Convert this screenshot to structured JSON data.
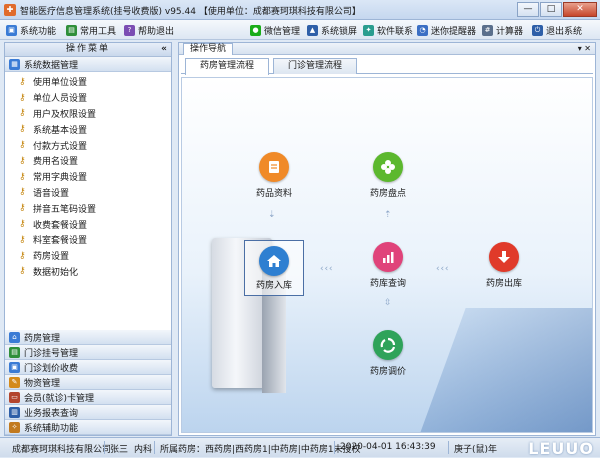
{
  "window": {
    "title": "智能医疗信息管理系统(挂号收费版) v95.44  【使用单位：成都赛珂琪科技有限公司】",
    "controls": [
      "—",
      "□",
      "✕"
    ]
  },
  "toolbar": {
    "left": [
      {
        "label": "系统功能",
        "icon": "monitor-icon",
        "color": "#3a7bd5"
      },
      {
        "label": "常用工具",
        "icon": "tools-icon",
        "color": "#2f8f3a"
      },
      {
        "label": "帮助退出",
        "icon": "help-icon",
        "color": "#7b4db3"
      }
    ],
    "right": [
      {
        "label": "微信管理",
        "icon": "wechat-icon",
        "color": "#1aad19"
      },
      {
        "label": "系统锁屏",
        "icon": "lock-icon",
        "color": "#2e5fa8"
      },
      {
        "label": "软件联系",
        "icon": "contact-icon",
        "color": "#2a9d8f"
      },
      {
        "label": "迷你提醒器",
        "icon": "reminder-icon",
        "color": "#3b6fc4"
      },
      {
        "label": "计算器",
        "icon": "calculator-icon",
        "color": "#5a6f8c"
      },
      {
        "label": "退出系统",
        "icon": "exit-icon",
        "color": "#2e5fa8"
      }
    ]
  },
  "sidebar": {
    "header": "操作菜单",
    "collapse": "«",
    "active_group": {
      "label": "系统数据管理",
      "icon": "database-icon",
      "color": "#3a7bd5"
    },
    "items": [
      "使用单位设置",
      "单位人员设置",
      "用户及权限设置",
      "系统基本设置",
      "付款方式设置",
      "费用名设置",
      "常用字典设置",
      "语音设置",
      "拼音五笔码设置",
      "收费套餐设置",
      "料室套餐设置",
      "药房设置",
      "数据初始化"
    ],
    "groups": [
      {
        "label": "药房管理",
        "icon": "home-icon",
        "color": "#3a7bd5"
      },
      {
        "label": "门诊挂号管理",
        "icon": "register-icon",
        "color": "#2f8f3a"
      },
      {
        "label": "门诊划价收费",
        "icon": "billing-icon",
        "color": "#3a7bd5"
      },
      {
        "label": "物资管理",
        "icon": "pencil-icon",
        "color": "#d48a1a"
      },
      {
        "label": "会员(就诊)卡管理",
        "icon": "card-icon",
        "color": "#b3452e"
      },
      {
        "label": "业务报表查询",
        "icon": "report-icon",
        "color": "#2e5fa8"
      },
      {
        "label": "系统辅助功能",
        "icon": "assist-icon",
        "color": "#c27a1f"
      }
    ]
  },
  "content": {
    "tab": "操作导航",
    "tab_controls": "▾ ✕",
    "subtabs": [
      "药房管理流程",
      "门诊管理流程"
    ],
    "flow": {
      "nodes": {
        "drug_info": {
          "label": "药品资料",
          "icon": "document-icon",
          "color": "#f08a28"
        },
        "inventory_check": {
          "label": "药房盘点",
          "icon": "clover-icon",
          "color": "#5cb82e"
        },
        "stock_in": {
          "label": "药房入库",
          "icon": "house-icon",
          "color": "#2e7fd1"
        },
        "stock_query": {
          "label": "药库查询",
          "icon": "chart-icon",
          "color": "#e0437a"
        },
        "stock_out": {
          "label": "药房出库",
          "icon": "download-arrow-icon",
          "color": "#e03a2a"
        },
        "transfer": {
          "label": "药房调价",
          "icon": "recycle-icon",
          "color": "#2fa35a"
        }
      },
      "arrow_glyph": "‹ ‹ ‹"
    }
  },
  "status": {
    "company": "成都赛珂琪科技有限公司",
    "user": "张三",
    "dept": "内科",
    "pharmacy": "所属药房：西药房|西药房1|中药房|中药房1未授权",
    "datetime": "2020-04-01 16:43:39",
    "lunar": "庚子(鼠)年",
    "watermark": "LEUUO"
  }
}
